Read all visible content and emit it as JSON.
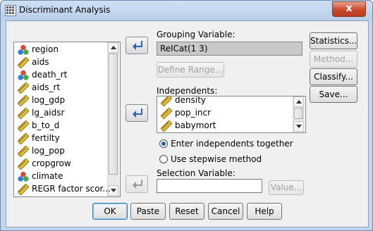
{
  "window": {
    "title": "Discriminant Analysis",
    "close_glyph": "x"
  },
  "variables_list": {
    "items": [
      {
        "label": "region",
        "icon": "nominal-variable-icon"
      },
      {
        "label": "aids",
        "icon": "scale-variable-icon"
      },
      {
        "label": "death_rt",
        "icon": "nominal-variable-icon"
      },
      {
        "label": "aids_rt",
        "icon": "scale-variable-icon"
      },
      {
        "label": "log_gdp",
        "icon": "scale-variable-icon"
      },
      {
        "label": "lg_aidsr",
        "icon": "scale-variable-icon"
      },
      {
        "label": "b_to_d",
        "icon": "scale-variable-icon"
      },
      {
        "label": "fertilty",
        "icon": "scale-variable-icon"
      },
      {
        "label": "log_pop",
        "icon": "scale-variable-icon"
      },
      {
        "label": "cropgrow",
        "icon": "scale-variable-icon"
      },
      {
        "label": "climate",
        "icon": "nominal-variable-icon"
      },
      {
        "label": "REGR factor scor...",
        "icon": "scale-variable-icon"
      }
    ]
  },
  "grouping": {
    "label": "Grouping Variable:",
    "value": "RelCat(1 3)",
    "define_range": "Define Range..."
  },
  "independents": {
    "label": "Independents:",
    "items": [
      {
        "label": "density",
        "icon": "scale-variable-icon"
      },
      {
        "label": "pop_incr",
        "icon": "scale-variable-icon"
      },
      {
        "label": "babymort",
        "icon": "scale-variable-icon"
      }
    ]
  },
  "method_options": {
    "enter": "Enter independents together",
    "stepwise": "Use stepwise method",
    "selected": "enter"
  },
  "selection": {
    "label": "Selection Variable:",
    "value": "",
    "value_button": "Value..."
  },
  "side_buttons": {
    "statistics": "Statistics...",
    "method": "Method...",
    "classify": "Classify...",
    "save": "Save..."
  },
  "bottom_buttons": {
    "ok": "OK",
    "paste": "Paste",
    "reset": "Reset",
    "cancel": "Cancel",
    "help": "Help"
  },
  "colors": {
    "accent": "#3a6fb6",
    "title_bar": "#c5d6ea"
  }
}
